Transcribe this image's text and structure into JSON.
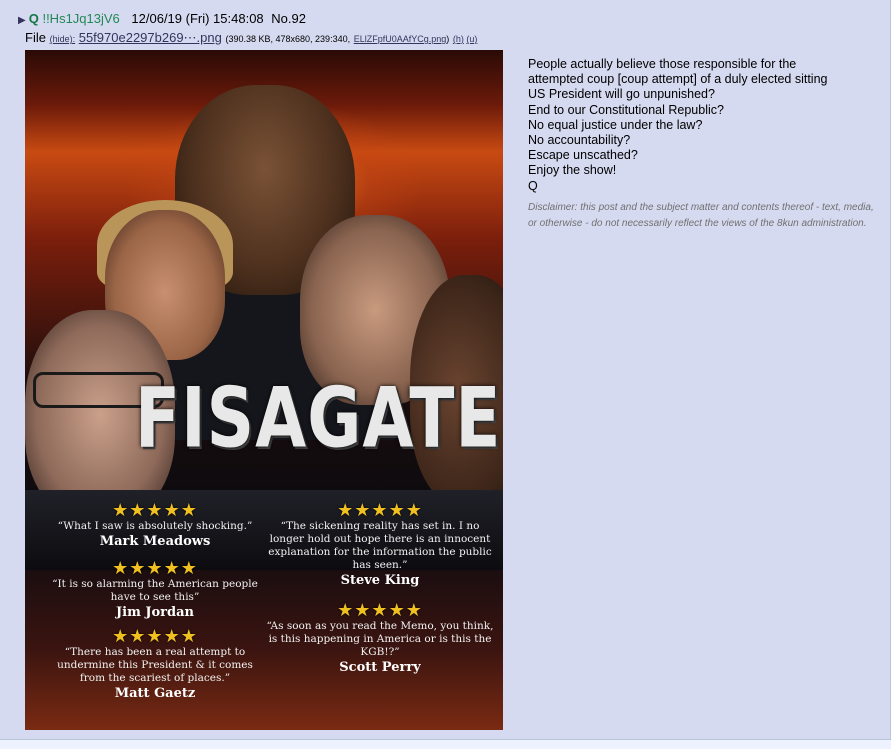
{
  "post": {
    "name": "Q",
    "tripcode": "!!Hs1Jq13jV6",
    "date": "12/06/19 (Fri) 15:48:08",
    "number_label": "No.",
    "number": "92",
    "file": {
      "label": "File",
      "hide_label": "(hide):",
      "filename": "55f970e2297b269⋯.png",
      "meta": "(390.38 KB, 478x680, 239:340,",
      "orig_name": "ELlZFpfU0AAfYCg.png",
      "close": ")",
      "h": "(h)",
      "u": "(u)"
    },
    "body_lines": [
      "People actually believe those responsible for the",
      "attempted coup [coup attempt] of a duly elected sitting",
      "US President will go unpunished?",
      "End to our Constitutional Republic?",
      "No equal justice under the law?",
      "No accountability?",
      "Escape unscathed?",
      "Enjoy the show!",
      "Q"
    ],
    "disclaimer": "Disclaimer: this post and the subject matter and contents thereof - text, media, or otherwise - do not necessarily reflect the views of the 8kun administration."
  },
  "image": {
    "title": "FISAGATE",
    "quotes": [
      {
        "stars": "★★★★★",
        "text": "“What I saw is absolutely shocking.”",
        "name": "Mark Meadows"
      },
      {
        "stars": "★★★★★",
        "text": "“The sickening reality has set in. I no longer hold out hope there is an innocent explanation for the information the public has seen.”",
        "name": "Steve King"
      },
      {
        "stars": "★★★★★",
        "text": "“It is so alarming the American people have to see this”",
        "name": "Jim Jordan"
      },
      {
        "stars": "★★★★★",
        "text": "“As soon as you read the Memo, you think, is this happening in America or is this the KGB!?”",
        "name": "Scott Perry"
      },
      {
        "stars": "★★★★★",
        "text": "“There has been a real attempt to undermine this President & it comes from the scariest of places.”",
        "name": "Matt Gaetz"
      }
    ]
  },
  "colors": {
    "post_bg": "#d6daf0",
    "page_bg": "#eef2ff",
    "name": "#117743",
    "link": "#34345c",
    "star": "#f0c020"
  }
}
